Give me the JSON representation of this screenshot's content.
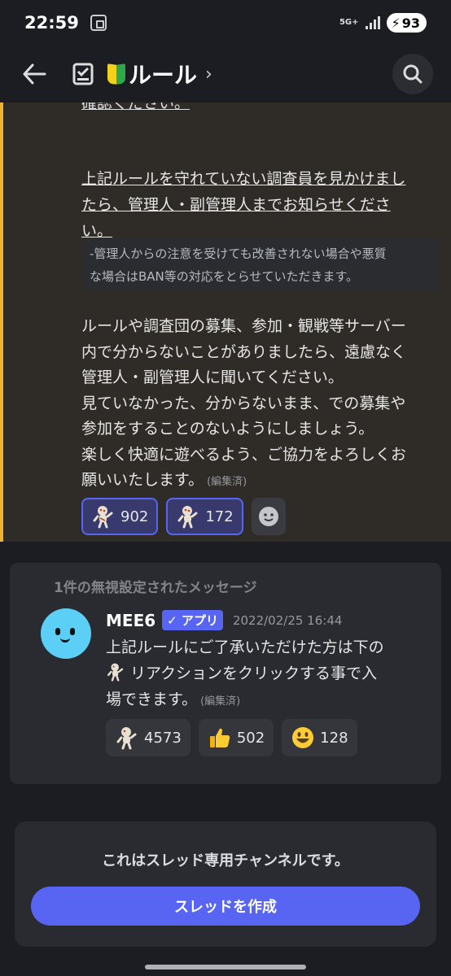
{
  "status_bar": {
    "time": "22:59",
    "network": "5G+",
    "battery": "93"
  },
  "header": {
    "channel_title": "ルール",
    "chevron": "›",
    "icons": [
      "back-arrow-icon",
      "channel-list-icon",
      "beginner-mark-icon",
      "search-icon"
    ]
  },
  "message": {
    "cut_text": "確認ください。",
    "warning_line1": "上記ルールを守れていない調査員を見かけまし",
    "warning_line2": "たら、管理人・副管理人までお知らせくださ",
    "warning_line3": "い。",
    "quote_line1": "-管理人からの注意を受けても改善されない場合や悪質",
    "quote_line2": "な場合はBAN等の対応をとらせていただきます。",
    "body_line1": "ルールや調査団の募集、参加・観戦等サーバー",
    "body_line2": "内で分からないことがありましたら、遠慮なく",
    "body_line3": "管理人・副管理人に聞いてください。",
    "body_line4": "見ていなかった、分からないまま、での募集や",
    "body_line5": "参加をすることのないようにしましょう。",
    "body_line6": "楽しく快適に遊べるよう、ご協力をよろしくお",
    "body_line7": "願いいたします。",
    "edited": "(編集済)",
    "reactions": [
      {
        "emoji": "voodoo-doll-emoji",
        "count": "902",
        "active": true
      },
      {
        "emoji": "voodoo-doll-emoji",
        "count": "172",
        "active": true
      }
    ]
  },
  "ignored": {
    "label": "1件の無視設定されたメッセージ",
    "author": "MEE6",
    "app_badge": "✓ アプリ",
    "timestamp": "2022/02/25 16:44",
    "text_line1": "上記ルールにご了承いただけた方は下の",
    "text_line2": "リアクションをクリックする事で入",
    "text_line3": "場できます。",
    "edited": "(編集済)",
    "reactions": [
      {
        "emoji": "voodoo-doll-emoji",
        "count": "4573"
      },
      {
        "emoji": "thumbs-up-emoji",
        "count": "502"
      },
      {
        "emoji": "grinning-face-emoji",
        "count": "128"
      }
    ]
  },
  "thread": {
    "notice": "これはスレッド専用チャンネルです。",
    "create_button": "スレッドを作成"
  },
  "colors": {
    "accent": "#5865f2",
    "highlight_bar": "#f0b232",
    "background": "#1c1d22"
  }
}
